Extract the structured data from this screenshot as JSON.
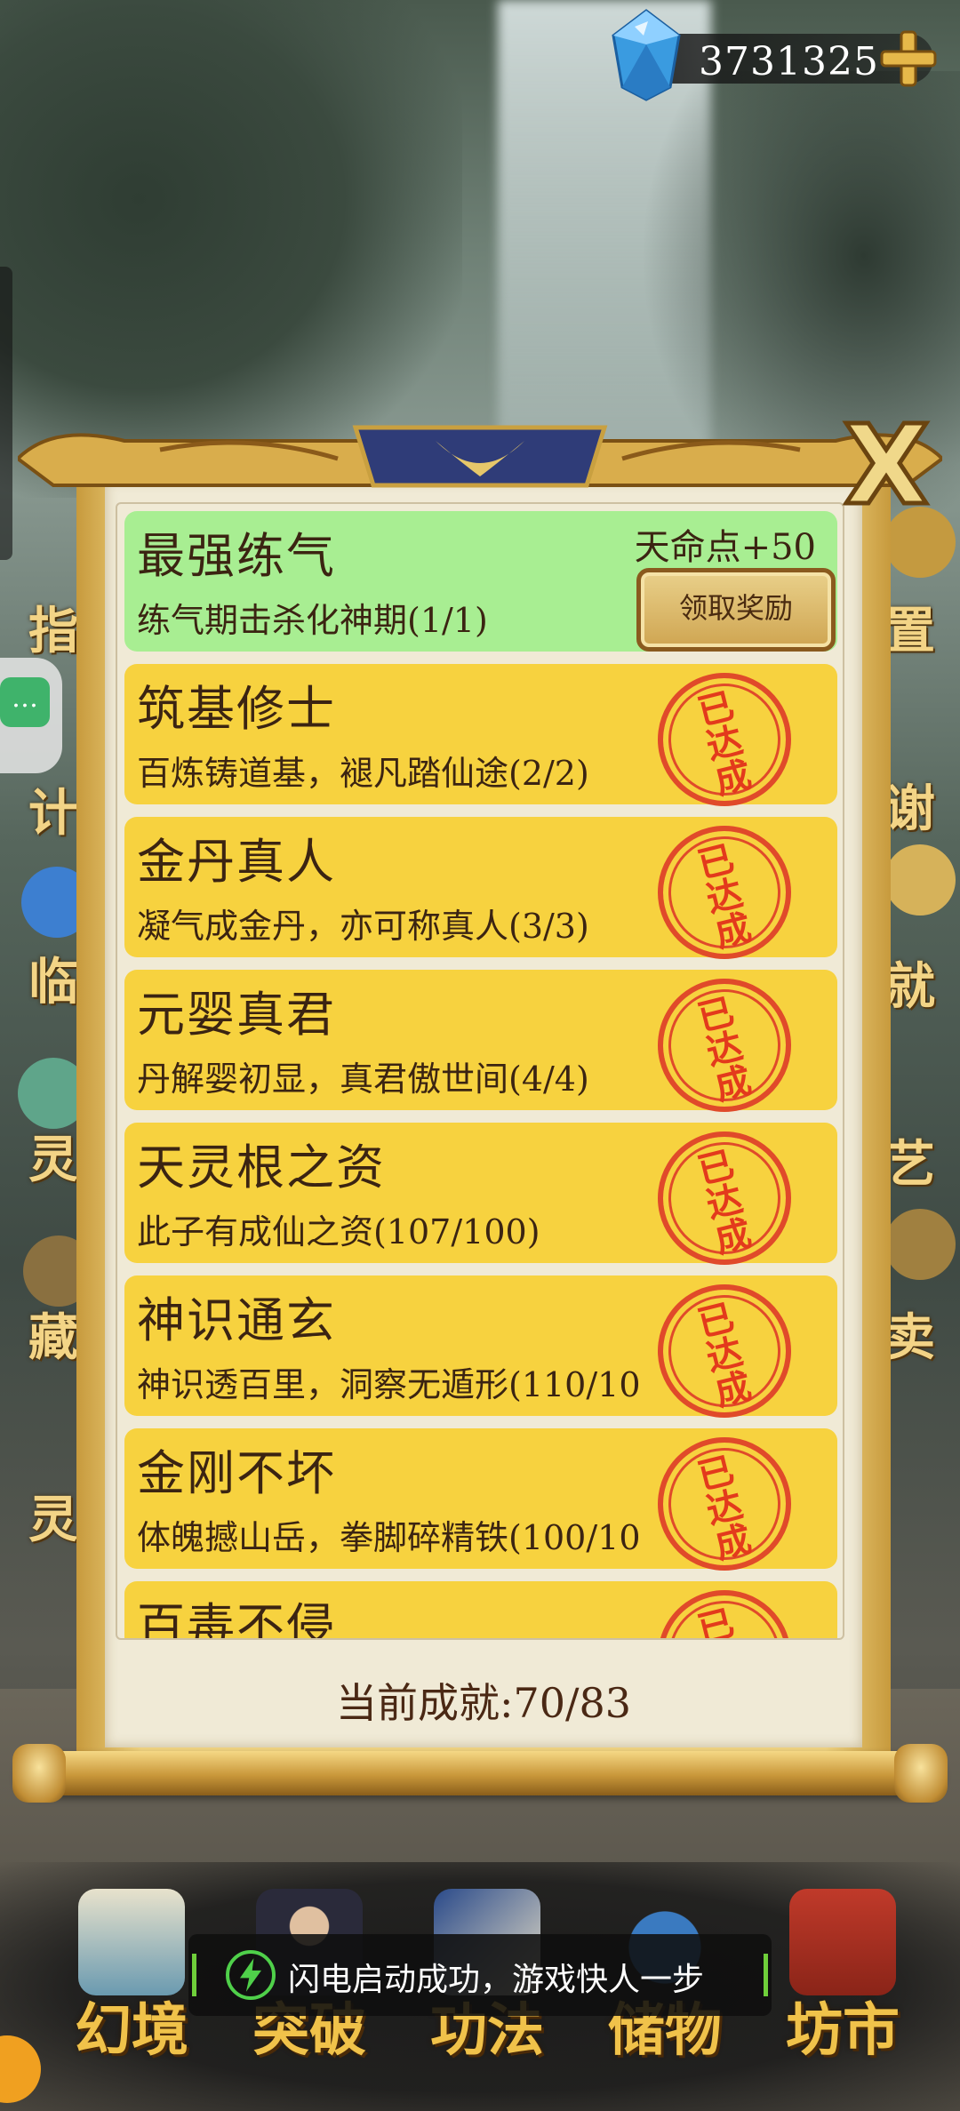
{
  "currency": {
    "value": "3731325",
    "icon": "gem-icon",
    "add_icon": "plus-icon"
  },
  "side_menu": {
    "left": [
      "指",
      "计",
      "临",
      "灵",
      "藏",
      "灵"
    ],
    "right": [
      "置",
      "谢",
      "就",
      "艺",
      "卖"
    ]
  },
  "achievements": [
    {
      "title": "最强练气",
      "desc": "练气期击杀化神期(1/1)",
      "status": "claimable",
      "reward": "天命点+50",
      "button": "领取奖励"
    },
    {
      "title": "筑基修士",
      "desc": "百炼铸道基，褪凡踏仙途(2/2)",
      "status": "done"
    },
    {
      "title": "金丹真人",
      "desc": "凝气成金丹，亦可称真人(3/3)",
      "status": "done"
    },
    {
      "title": "元婴真君",
      "desc": "丹解婴初显，真君傲世间(4/4)",
      "status": "done"
    },
    {
      "title": "天灵根之资",
      "desc": "此子有成仙之资(107/100)",
      "status": "done"
    },
    {
      "title": "神识通玄",
      "desc": "神识透百里，洞察无遁形(110/10",
      "status": "done"
    },
    {
      "title": "金刚不坏",
      "desc": "体魄撼山岳，拳脚碎精铁(100/10",
      "status": "done"
    },
    {
      "title": "百毒不侵",
      "desc": "",
      "status": "done"
    }
  ],
  "stamp_text": [
    "已",
    "达",
    "成"
  ],
  "summary": {
    "label": "当前成就:70/83"
  },
  "toast": {
    "text": "闪电启动成功，游戏快人一步",
    "icon": "lightning-icon"
  },
  "bottom_nav": [
    {
      "label": "幻境",
      "icon": "scroll-painting-icon"
    },
    {
      "label": "突破",
      "icon": "cultivator-icon"
    },
    {
      "label": "功法",
      "icon": "book-icon"
    },
    {
      "label": "储物",
      "icon": "pouch-icon"
    },
    {
      "label": "坊市",
      "icon": "market-gate-icon"
    }
  ],
  "colors": {
    "done_card": "#f7d23f",
    "claim_card": "#a8ee92",
    "stamp_red": "#e04a2a",
    "gold": "#f0c24a",
    "paper": "#f0ead6"
  }
}
